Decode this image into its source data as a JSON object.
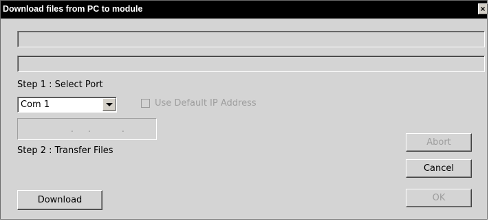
{
  "window": {
    "title": "Download files from PC to module",
    "close_label": "×"
  },
  "status": {
    "line1": "",
    "line2": ""
  },
  "step1": {
    "label": "Step 1 : Select Port",
    "port_value": "Com 1",
    "use_default_ip_label": "Use Default IP Address",
    "use_default_ip_checked": false,
    "ip_address_dots": [
      ".",
      ".",
      "."
    ]
  },
  "step2": {
    "label": "Step 2 : Transfer Files"
  },
  "buttons": {
    "download": "Download",
    "abort": "Abort",
    "cancel": "Cancel",
    "ok": "OK"
  }
}
